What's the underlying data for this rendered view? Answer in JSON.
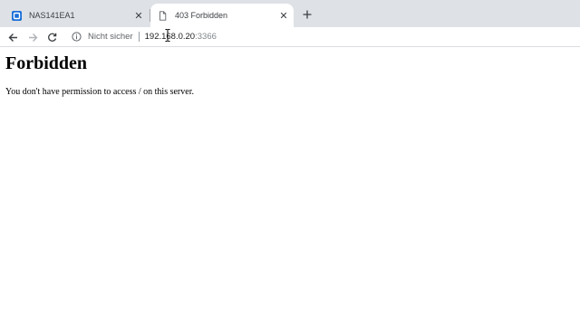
{
  "tabs": [
    {
      "title": "NAS141EA1",
      "favicon": "nas-app-icon",
      "active": false
    },
    {
      "title": "403 Forbidden",
      "favicon": "page-icon",
      "active": true
    }
  ],
  "toolbar": {
    "security_text": "Nicht sicher",
    "url_host": "192.168.0.20",
    "url_port": ":3366"
  },
  "page": {
    "heading": "Forbidden",
    "message": "You don't have permission to access / on this server."
  },
  "colors": {
    "tabstrip": "#dee1e6",
    "favicon_brand": "#1a6fd8",
    "text": "#000000"
  }
}
